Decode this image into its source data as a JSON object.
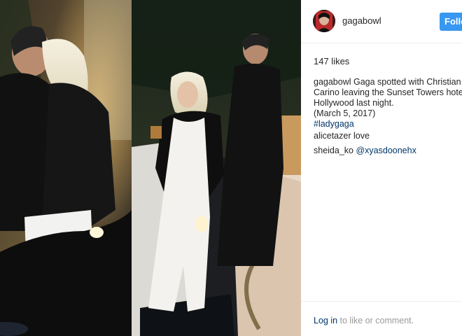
{
  "post": {
    "username": "gagabowl",
    "follow_label": "Follow",
    "likes": "147 likes",
    "caption": {
      "username": "gagabowl",
      "lines": [
        "Gaga spotted with Christian",
        "Carino leaving the Sunset Towers hotel",
        "Hollywood last night.",
        "(March 5, 2017)"
      ],
      "hashtag": "#ladygaga"
    },
    "comments": [
      {
        "username": "alicetazer",
        "text": "love"
      },
      {
        "username": "sheida_ko",
        "mention": "@xyasdoonehx"
      }
    ],
    "footer": {
      "login_label": "Log in",
      "rest": " to like or comment."
    }
  },
  "colors": {
    "follow_button": "#3897f0",
    "link": "#003569",
    "muted": "#999999",
    "text": "#262626"
  },
  "icons": {
    "avatar": "profile-avatar-photo"
  }
}
